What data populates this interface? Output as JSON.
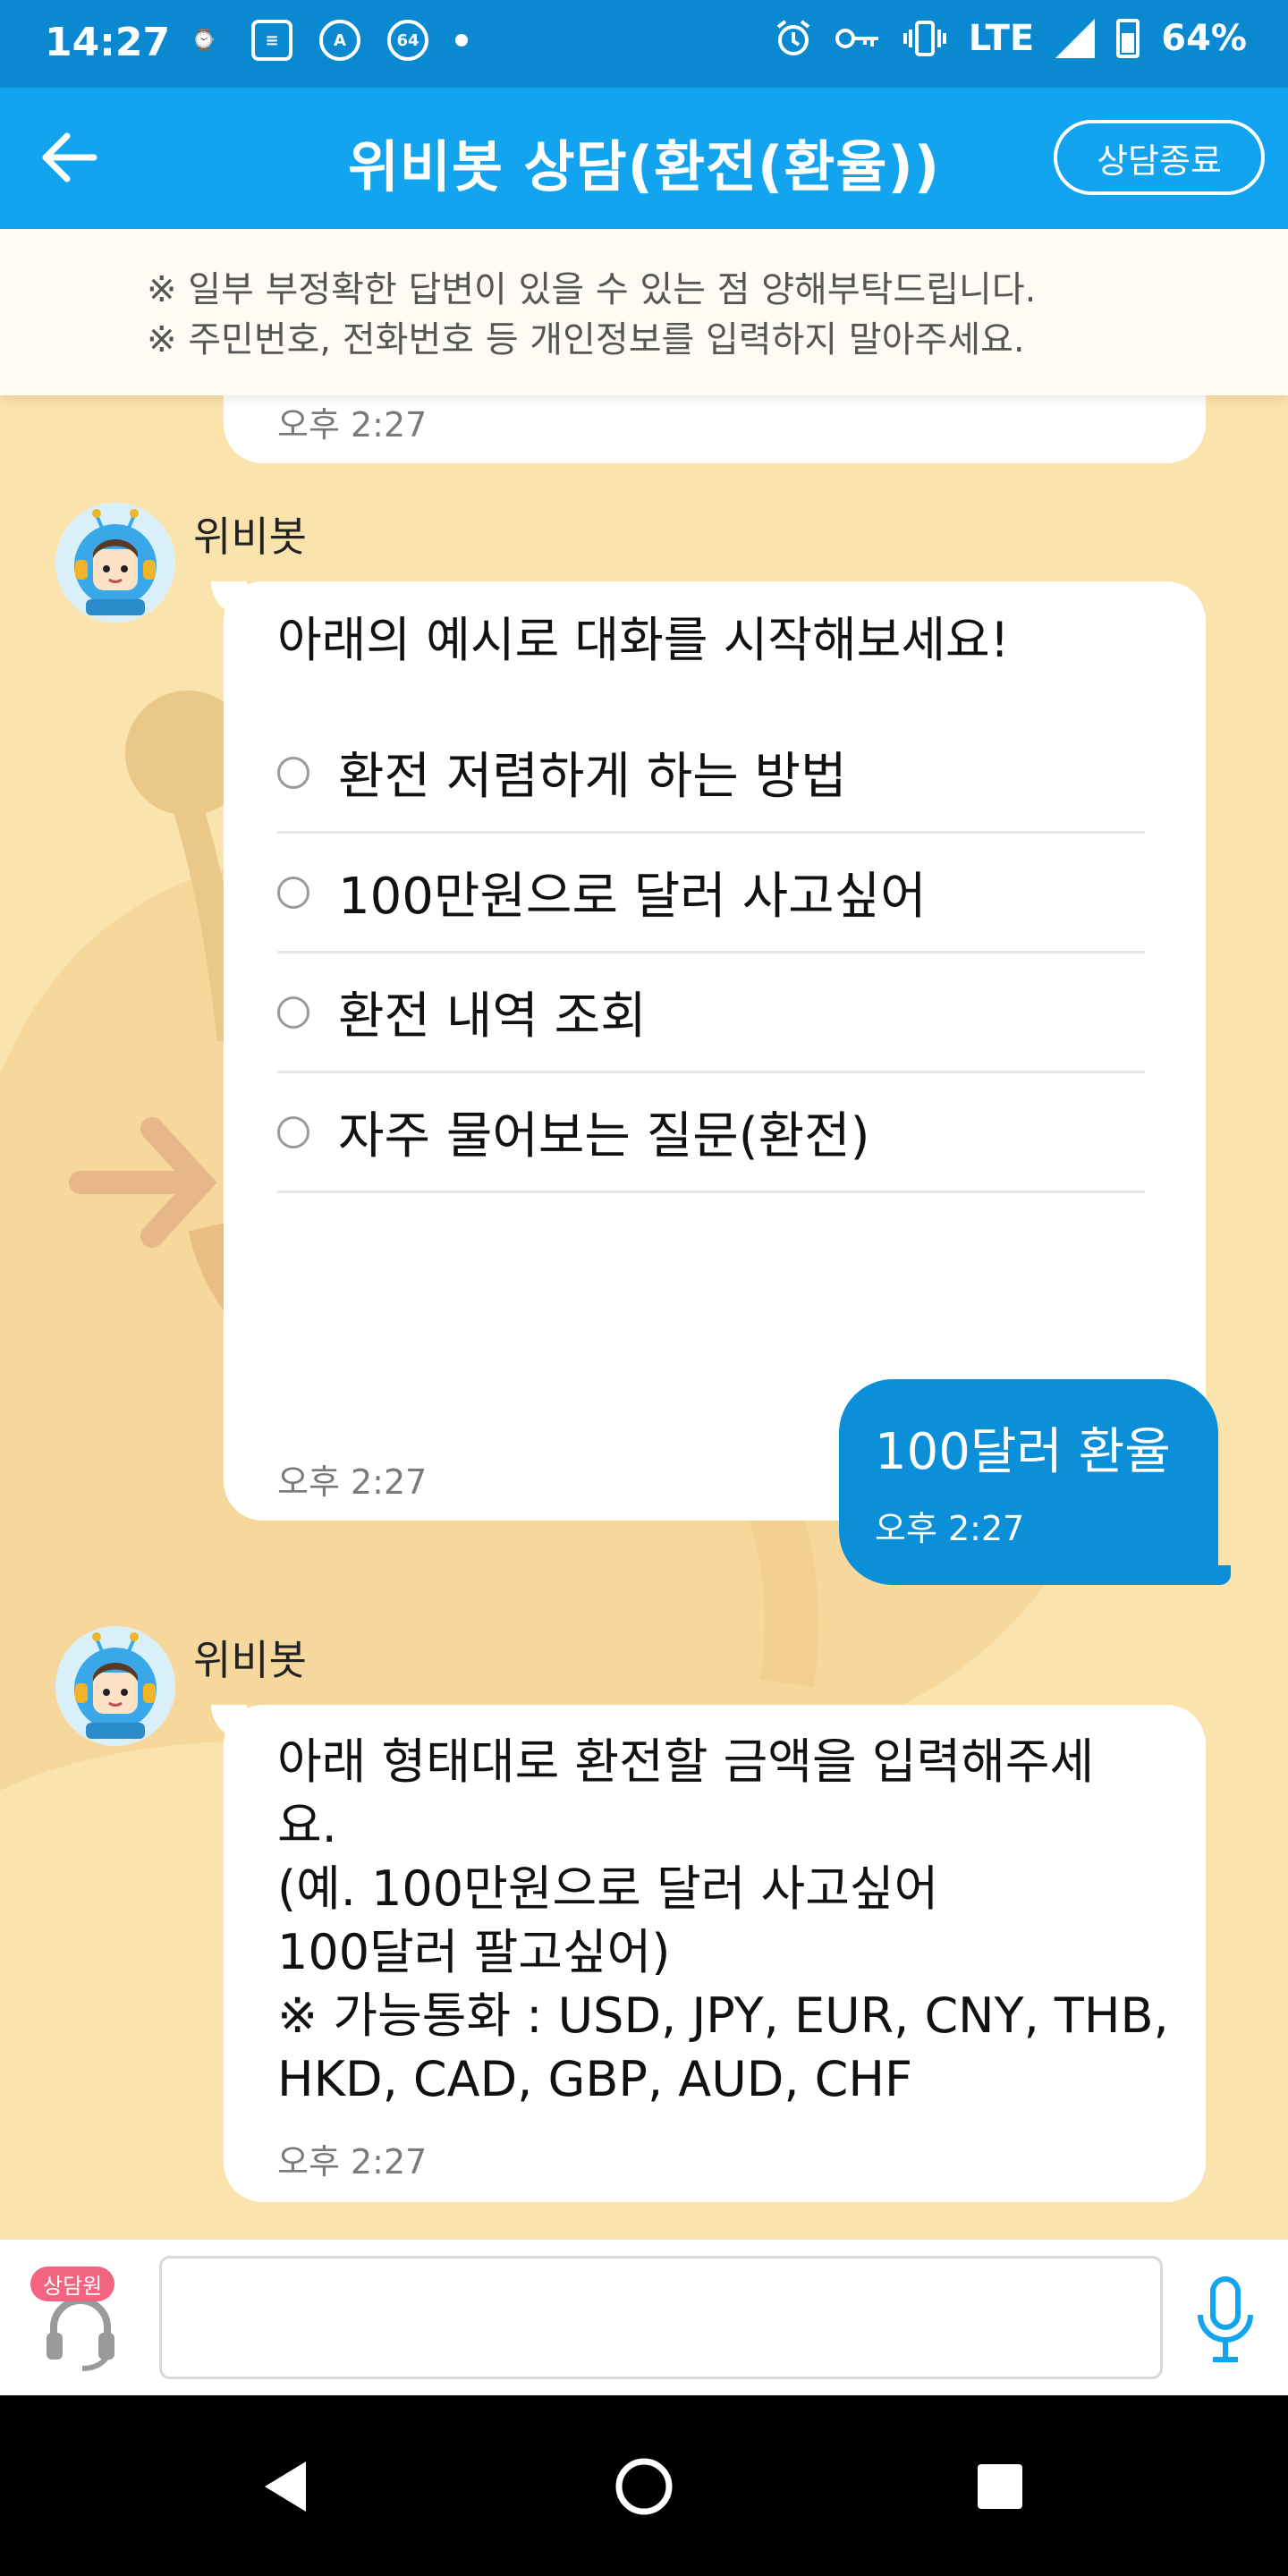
{
  "status_bar": {
    "time": "14:27",
    "notif_badge": "64",
    "network": "LTE",
    "battery": "64%"
  },
  "header": {
    "title": "위비봇 상담(환전(환율))",
    "end_button": "상담종료",
    "back_icon": "arrow-left-icon"
  },
  "notice": {
    "line1": "※ 일부 부정확한 답변이 있을 수 있는 점 양해부탁드립니다.",
    "line2": "※ 주민번호, 전화번호 등 개인정보를 입력하지 말아주세요."
  },
  "messages": {
    "partial_time": "오후 2:27",
    "bot1": {
      "sender": "위비봇",
      "text": "아래의 예시로 대화를 시작해보세요!",
      "options": [
        "환전 저렴하게 하는 방법",
        "100만원으로 달러 사고싶어",
        "환전 내역 조회",
        "자주 물어보는 질문(환전)"
      ],
      "time": "오후 2:27"
    },
    "user1": {
      "text": "100달러 환율",
      "time": "오후 2:27"
    },
    "bot2": {
      "sender": "위비봇",
      "lines": [
        "아래 형태대로 환전할 금액을 입력해주세",
        "요.",
        "(예. 100만원으로 달러 사고싶어",
        "100달러 팔고싶어)",
        "※ 가능통화 : USD, JPY, EUR, CNY, THB,",
        "HKD, CAD, GBP, AUD, CHF"
      ],
      "time": "오후 2:27"
    }
  },
  "input_bar": {
    "agent_badge": "상담원",
    "input_value": "",
    "input_placeholder": ""
  },
  "colors": {
    "status_bar": "#0a88d0",
    "header": "#12a4ee",
    "chat_bg": "#fbe3ae",
    "user_bubble": "#0b8fd9",
    "agent_badge": "#f2647f"
  }
}
